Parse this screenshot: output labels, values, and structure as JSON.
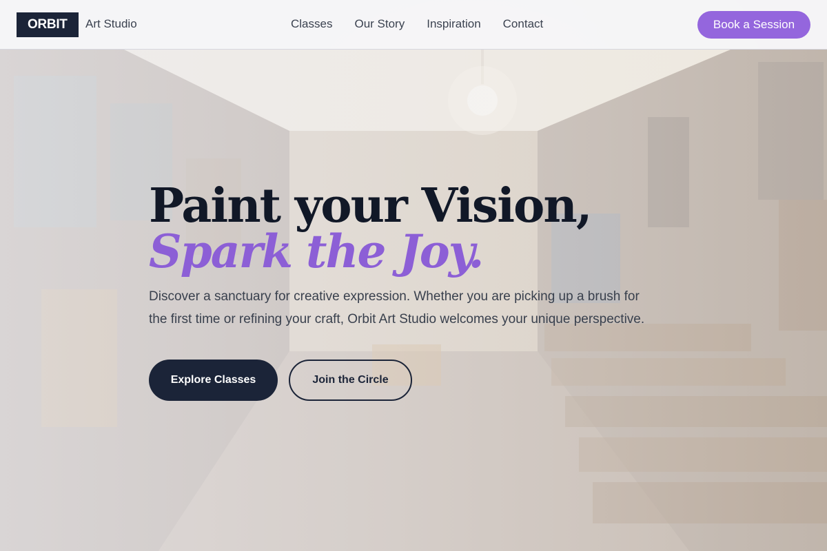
{
  "header": {
    "logo_text": "ORBIT",
    "brand_subtitle": "Art Studio",
    "nav": [
      {
        "label": "Classes"
      },
      {
        "label": "Our Story"
      },
      {
        "label": "Inspiration"
      },
      {
        "label": "Contact"
      }
    ],
    "cta_label": "Book a Session"
  },
  "hero": {
    "title_line1": "Paint your Vision,",
    "title_line2": "Spark the Joy.",
    "description": "Discover a sanctuary for creative expression. Whether you are picking up a brush for the first time or refining your craft, Orbit Art Studio welcomes your unique perspective.",
    "primary_button": "Explore Classes",
    "secondary_button": "Join the Circle"
  },
  "colors": {
    "navy": "#1b2438",
    "accent_purple": "#9466dd",
    "text_gray": "#39404d"
  }
}
